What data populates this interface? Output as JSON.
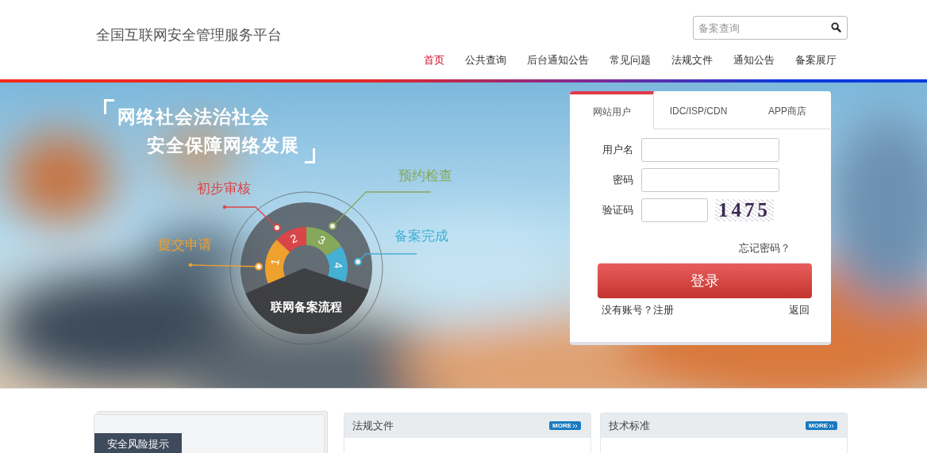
{
  "header": {
    "site_title": "全国互联网安全管理服务平台",
    "search": {
      "placeholder": "备案查询"
    },
    "nav": [
      {
        "label": "首页",
        "selected": true
      },
      {
        "label": "公共查询",
        "selected": false
      },
      {
        "label": "后台通知公告",
        "selected": false
      },
      {
        "label": "常见问题",
        "selected": false
      },
      {
        "label": "法规文件",
        "selected": false
      },
      {
        "label": "通知公告",
        "selected": false
      },
      {
        "label": "备案展厅",
        "selected": false
      }
    ]
  },
  "banner": {
    "slogan": [
      "网络社会法治社会",
      "安全保障网络发展"
    ],
    "flow": {
      "title": "联网备案流程",
      "steps": [
        {
          "number": "1",
          "label": "提交申请",
          "color": "#eea12e"
        },
        {
          "number": "2",
          "label": "初步审核",
          "color": "#d8464a"
        },
        {
          "number": "3",
          "label": "预约检查",
          "color": "#86a85a"
        },
        {
          "number": "4",
          "label": "备案完成",
          "color": "#45b0d4"
        }
      ]
    }
  },
  "login": {
    "tabs": [
      {
        "label": "网站用户",
        "selected": true
      },
      {
        "label": "IDC/ISP/CDN",
        "selected": false
      },
      {
        "label": "APP商店",
        "selected": false
      }
    ],
    "fields": [
      {
        "label": "用户名",
        "kind": "text"
      },
      {
        "label": "密码",
        "kind": "password"
      },
      {
        "label": "验证码",
        "kind": "captcha",
        "captcha": "1475"
      }
    ],
    "forgot_link": "忘记密码？",
    "submit": "登录",
    "register_link": "没有账号？注册",
    "back_link": "返回"
  },
  "sections": [
    {
      "kind": "tag",
      "title": "安全风险提示"
    },
    {
      "kind": "panel",
      "title": "法规文件",
      "more": "MORE"
    },
    {
      "kind": "panel",
      "title": "技术标准",
      "more": "MORE"
    }
  ]
}
